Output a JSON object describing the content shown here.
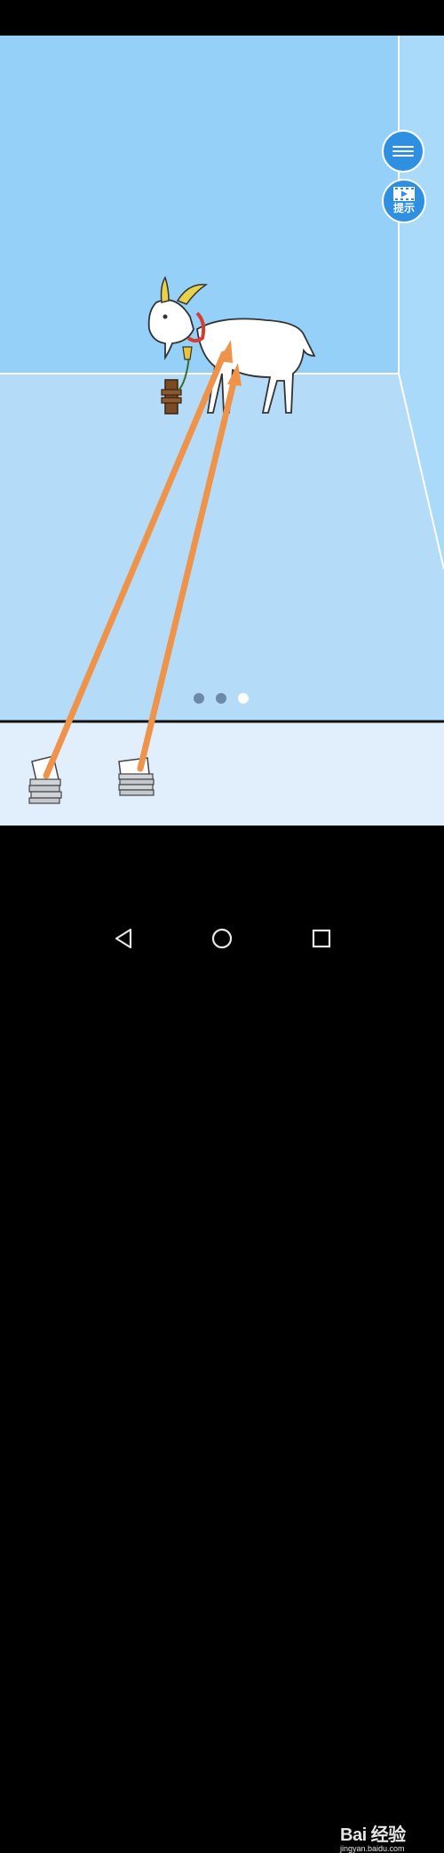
{
  "hud": {
    "menu_icon": "hamburger-icon",
    "hint_icon": "film-icon",
    "hint_label": "提示"
  },
  "pager": {
    "dots_total": 3,
    "active_index": 2
  },
  "scene": {
    "goat_collar_color": "#d63b2e",
    "horn_color": "#e8d24a",
    "arrow_color": "#f0934a"
  },
  "navigation": {
    "back_icon": "back-triangle-icon",
    "home_icon": "home-circle-icon",
    "recents_icon": "recents-square-icon"
  },
  "watermark": {
    "brand": "Bai 经验",
    "url": "jingyan.baidu.com"
  }
}
